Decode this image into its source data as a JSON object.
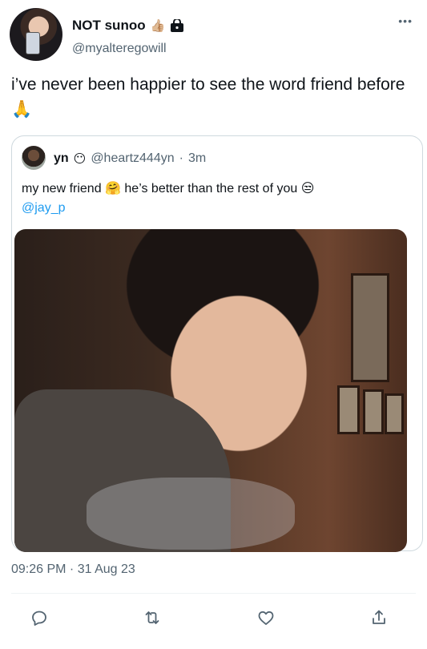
{
  "author": {
    "display_name": "NOT sunoo",
    "name_emoji": "👍🏼",
    "handle": "@myalteregowill",
    "more": "•••"
  },
  "tweet": {
    "text": "i’ve never been happier to see the word friend before 🙏"
  },
  "quote": {
    "display_name": "yn",
    "name_emoji": "😶",
    "handle": "@heartz444yn",
    "separator": "·",
    "time": "3m",
    "text": "my new friend 🤗  he’s better than the rest of you 😒",
    "mention": "@jay_p"
  },
  "meta": {
    "timestamp": "09:26 PM · 31 Aug 23"
  },
  "colors": {
    "text": "#0f1419",
    "secondary": "#536471",
    "link": "#1d9bf0",
    "border": "#cfd9de"
  },
  "icons": [
    "lock-icon",
    "more-icon",
    "reply-icon",
    "retweet-icon",
    "like-icon",
    "share-icon"
  ]
}
